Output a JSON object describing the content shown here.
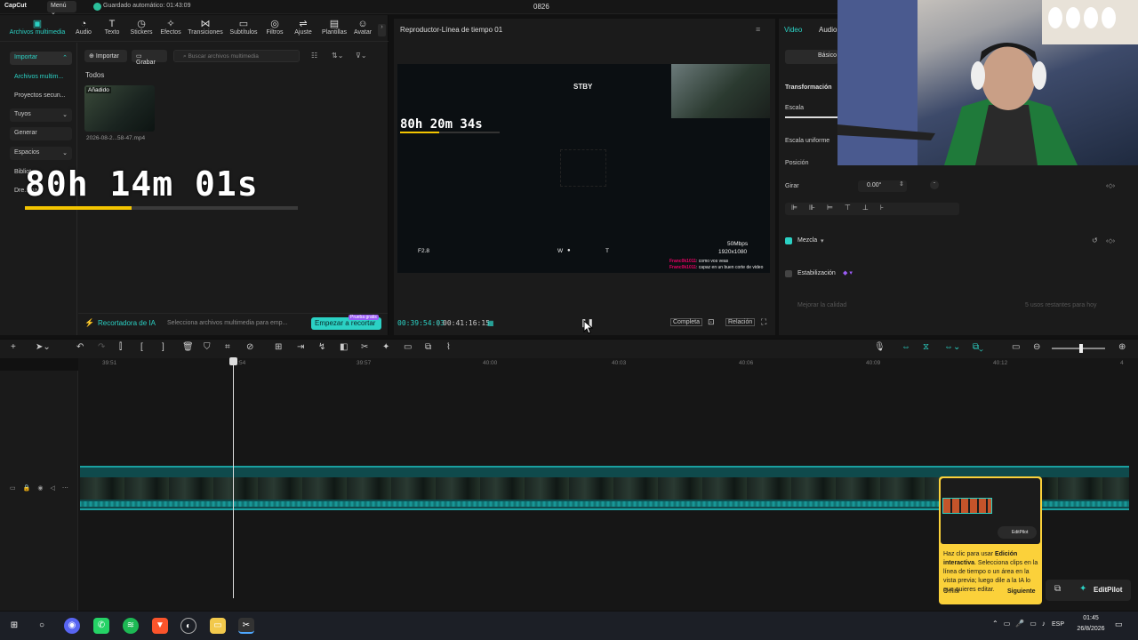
{
  "titlebar": {
    "logo": "CapCut",
    "menu": "Menú ⌄",
    "autosave": "Guardado automático: 01:43:09",
    "project": "0826"
  },
  "toolbar": {
    "items": [
      {
        "label": "Archivos multimedia",
        "icon": "media-icon"
      },
      {
        "label": "Audio",
        "icon": "audio-icon"
      },
      {
        "label": "Texto",
        "icon": "text-icon"
      },
      {
        "label": "Stickers",
        "icon": "sticker-icon"
      },
      {
        "label": "Efectos",
        "icon": "effects-icon"
      },
      {
        "label": "Transiciones",
        "icon": "transitions-icon"
      },
      {
        "label": "Subtítulos",
        "icon": "subtitles-icon"
      },
      {
        "label": "Filtros",
        "icon": "filters-icon"
      },
      {
        "label": "Ajuste",
        "icon": "adjust-icon"
      },
      {
        "label": "Plantillas",
        "icon": "templates-icon"
      },
      {
        "label": "Avatar",
        "icon": "avatar-icon"
      }
    ]
  },
  "sidebar": {
    "items": [
      {
        "label": "Importar"
      },
      {
        "label": "Archivos multim..."
      },
      {
        "label": "Proyectos secun..."
      },
      {
        "label": "Tuyos"
      },
      {
        "label": "Generar"
      },
      {
        "label": "Espacios"
      },
      {
        "label": "Bibliot..."
      },
      {
        "label": "Dre...ina"
      }
    ]
  },
  "media": {
    "import_btn": "Importar",
    "record_btn": "Grabar",
    "search_placeholder": "Buscar archivos multimedia",
    "section": "Todos",
    "thumb_badge": "Añadido",
    "thumb_name": "2026-08-2...58-47.mp4"
  },
  "overlay": {
    "timer": "80h 14m 01s",
    "progress": 0.39
  },
  "ai_bar": {
    "title": "Recortadora de IA",
    "desc": "Selecciona archivos multimedia para emp...",
    "button": "Empezar a recortar",
    "tag": "Prueba gratis"
  },
  "player": {
    "title": "Reproductor-Línea de tiempo 01",
    "stby": "STBY",
    "timer": "80h 20m 34s",
    "timer_progress": 0.39,
    "aperture": "F2.8",
    "w": "W",
    "t": "T",
    "bitrate": "50Mbps",
    "resolution": "1920x1080",
    "chat1_user": "Franc0k1011",
    "chat1_msg": ": como vos veas",
    "chat2_user": "Franc0k1011",
    "chat2_msg": ": capaz en un buen corte de video",
    "current_time": "00:39:54:03",
    "total_time": "00:41:16:15",
    "btn_full": "Completa",
    "btn_ratio": "Relación"
  },
  "props": {
    "tabs": [
      "Video",
      "Audio"
    ],
    "basico": "Básico",
    "transformacion": "Transformación",
    "escala": "Escala",
    "escala_uniforme": "Escala uniforme",
    "posicion": "Posición",
    "girar": "Girar",
    "rotation": "0.00°",
    "mezcla": "Mezcla",
    "estabilizacion": "Estabilización",
    "mejorar": "Mejorar la calidad",
    "mejorar_right": "5 usos restantes para hoy"
  },
  "ruler": {
    "ticks": [
      "39:51",
      "39:54",
      "39:57",
      "40:00",
      "40:03",
      "40:06",
      "40:09",
      "40:12",
      "4"
    ]
  },
  "tip": {
    "text_pre": "Haz clic para usar ",
    "text_bold": "Edición interactiva",
    "text_post": ". Selecciona clips en la línea de tiempo o un área en la vista previa; luego dile a la IA lo que quieres editar.",
    "skip": "Omitir",
    "next": "Siguiente",
    "preview_label": "EditPilot"
  },
  "editpilot": {
    "label": "EditPilot"
  },
  "taskbar": {
    "lang": "ESP",
    "time": "01:45",
    "date": "26/8/2026"
  },
  "colors": {
    "accent": "#2bd1c4",
    "timer_bar": "#f3c500",
    "tip_bg": "#fbd13a"
  }
}
